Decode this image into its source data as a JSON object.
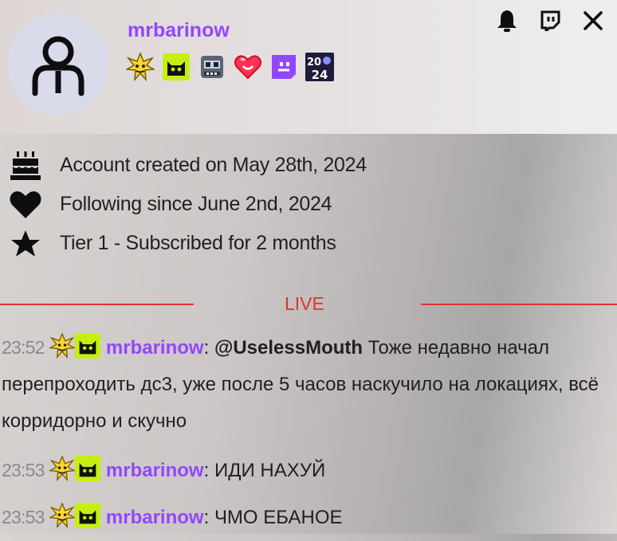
{
  "user": {
    "username": "mrbarinow",
    "badges": [
      "sparkle-face-badge",
      "cat-badge",
      "robot-badge",
      "pixel-heart-badge",
      "purple-glitch-badge",
      "year-2024-badge"
    ],
    "year_badge_top": "20",
    "year_badge_bottom": "24"
  },
  "header_actions": [
    "bell-icon",
    "twitch-logo-icon",
    "close-icon"
  ],
  "info": [
    {
      "icon": "cake-icon",
      "text": "Account created on May 28th, 2024"
    },
    {
      "icon": "heart-icon",
      "text": "Following since June 2nd, 2024"
    },
    {
      "icon": "star-icon",
      "text": "Tier 1 - Subscribed for 2 months"
    }
  ],
  "live_label": "LIVE",
  "messages": [
    {
      "time": "23:52",
      "user": "mrbarinow",
      "mention": "@UselessMouth",
      "text": "Тоже недавно начал перепроходить дс3, уже после 5 часов наскучило на локациях, всё корридорно и скучно"
    },
    {
      "time": "23:53",
      "user": "mrbarinow",
      "mention": "",
      "text": "ИДИ НАХУЙ"
    },
    {
      "time": "23:53",
      "user": "mrbarinow",
      "mention": "",
      "text": "ЧМО ЕБАНОЕ"
    }
  ],
  "colors": {
    "username": "#9147ff",
    "live": "#e0332f",
    "badge_green": "#c5f00f"
  }
}
